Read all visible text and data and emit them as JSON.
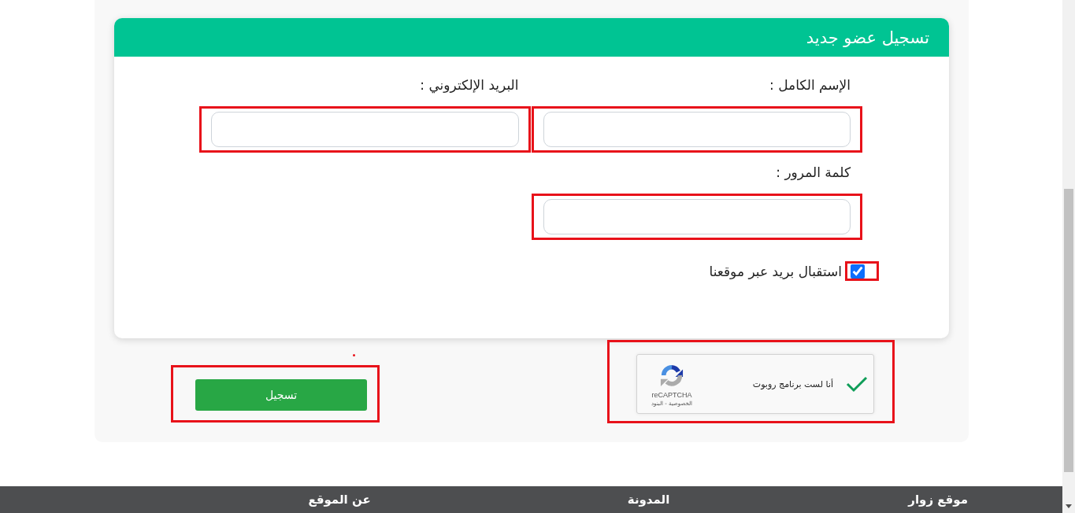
{
  "header": {
    "title": "تسجيل عضو جديد"
  },
  "fields": [
    {
      "label": "الإسم الكامل :"
    },
    {
      "label": "البريد الإلكتروني :"
    },
    {
      "label": "كلمة المرور :"
    }
  ],
  "newsletter": {
    "label": "استقبال بريد عبر موقعنا",
    "checked": true
  },
  "captcha": {
    "text": "أنا لست برنامج روبوت",
    "checked": true,
    "brand": "reCAPTCHA",
    "links": "الخصوصية - البنود"
  },
  "submit_button": {
    "label": "تسجيل"
  },
  "footer": {
    "columns": [
      "موقع زوار",
      "المدونة",
      "عن الموقع"
    ]
  }
}
